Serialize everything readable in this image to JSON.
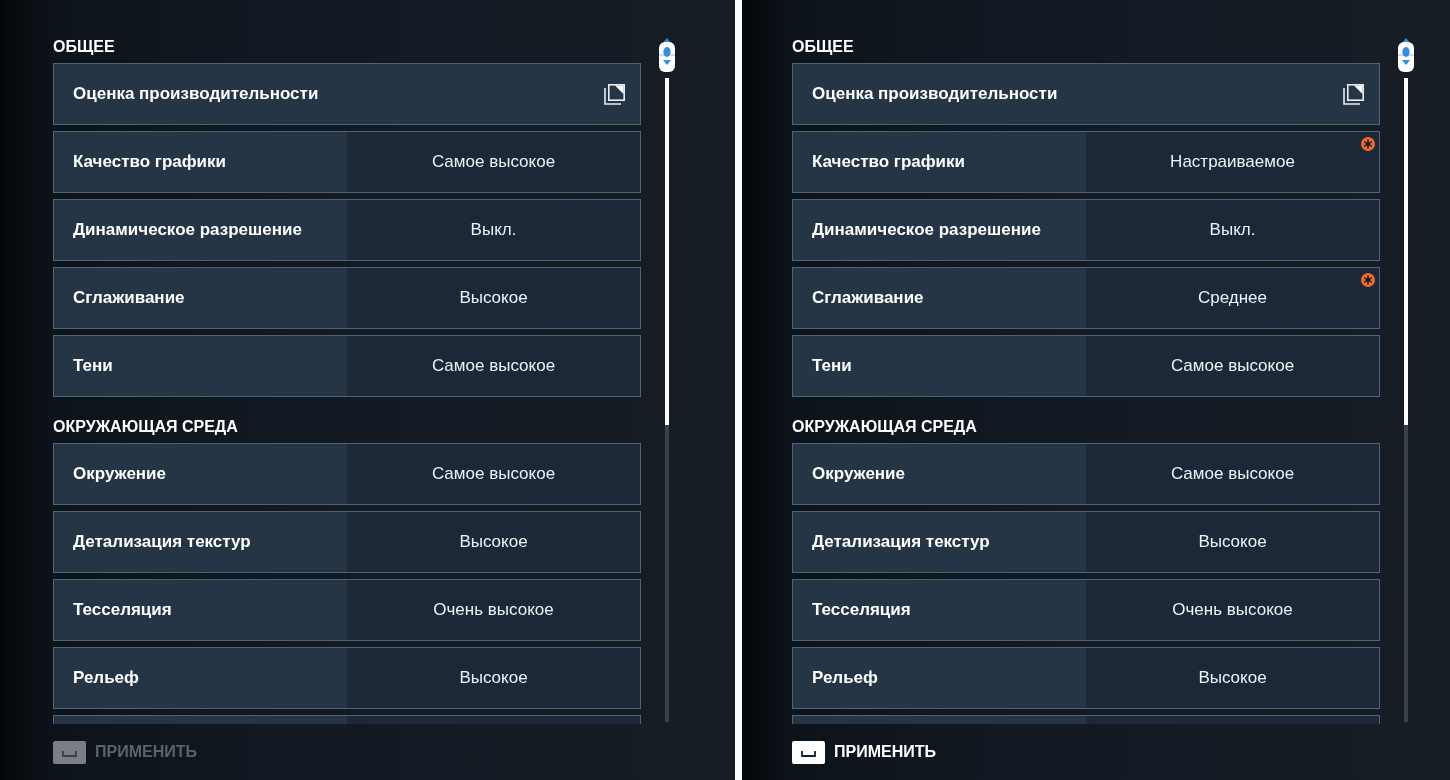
{
  "panels": [
    {
      "sections": [
        {
          "title": "ОБЩЕЕ",
          "rows": [
            {
              "kind": "link",
              "label": "Оценка производительности"
            },
            {
              "kind": "option",
              "label": "Качество графики",
              "value": "Самое высокое",
              "modified": false
            },
            {
              "kind": "option",
              "label": "Динамическое разрешение",
              "value": "Выкл.",
              "modified": false
            },
            {
              "kind": "option",
              "label": "Сглаживание",
              "value": "Высокое",
              "modified": false
            },
            {
              "kind": "option",
              "label": "Тени",
              "value": "Самое высокое",
              "modified": false
            }
          ]
        },
        {
          "title": "ОКРУЖАЮЩАЯ СРЕДА",
          "rows": [
            {
              "kind": "option",
              "label": "Окружение",
              "value": "Самое высокое",
              "modified": false
            },
            {
              "kind": "option",
              "label": "Детализация текстур",
              "value": "Высокое",
              "modified": false
            },
            {
              "kind": "option",
              "label": "Тесселяция",
              "value": "Очень высокое",
              "modified": false
            },
            {
              "kind": "option",
              "label": "Рельеф",
              "value": "Высокое",
              "modified": false
            }
          ]
        }
      ],
      "apply": {
        "label": "ПРИМЕНИТЬ",
        "disabled": true
      }
    },
    {
      "sections": [
        {
          "title": "ОБЩЕЕ",
          "rows": [
            {
              "kind": "link",
              "label": "Оценка производительности"
            },
            {
              "kind": "option",
              "label": "Качество графики",
              "value": "Настраиваемое",
              "modified": true
            },
            {
              "kind": "option",
              "label": "Динамическое разрешение",
              "value": "Выкл.",
              "modified": false
            },
            {
              "kind": "option",
              "label": "Сглаживание",
              "value": "Среднее",
              "modified": true
            },
            {
              "kind": "option",
              "label": "Тени",
              "value": "Самое высокое",
              "modified": false
            }
          ]
        },
        {
          "title": "ОКРУЖАЮЩАЯ СРЕДА",
          "rows": [
            {
              "kind": "option",
              "label": "Окружение",
              "value": "Самое высокое",
              "modified": false
            },
            {
              "kind": "option",
              "label": "Детализация текстур",
              "value": "Высокое",
              "modified": false
            },
            {
              "kind": "option",
              "label": "Тесселяция",
              "value": "Очень высокое",
              "modified": false
            },
            {
              "kind": "option",
              "label": "Рельеф",
              "value": "Высокое",
              "modified": false
            }
          ]
        }
      ],
      "apply": {
        "label": "ПРИМЕНИТЬ",
        "disabled": false
      }
    }
  ]
}
